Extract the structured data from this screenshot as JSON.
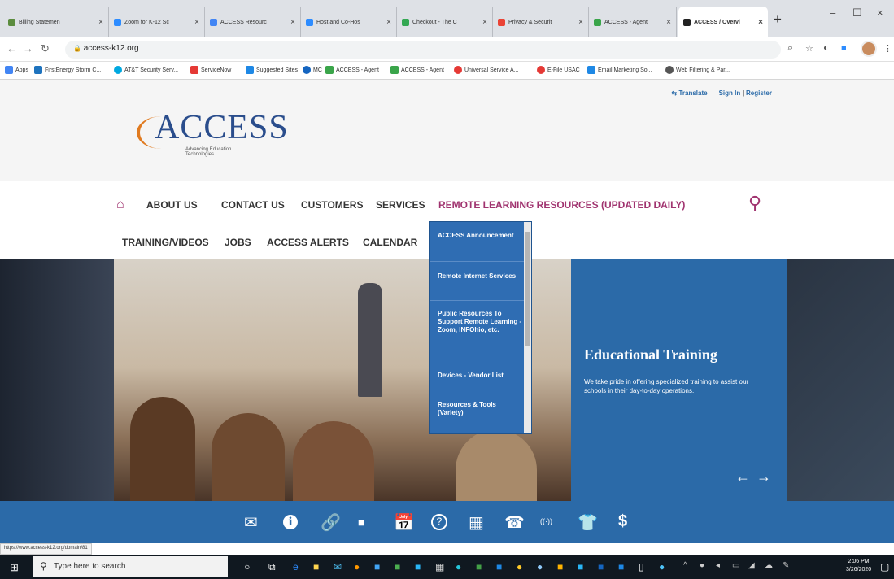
{
  "browser": {
    "tabs": [
      {
        "title": "Billing Statemen",
        "color": "#5b8c3e"
      },
      {
        "title": "Zoom for K-12 Sc",
        "color": "#2d8cff"
      },
      {
        "title": "ACCESS Resourc",
        "color": "#4285f4"
      },
      {
        "title": "Host and Co-Hos",
        "color": "#2d8cff"
      },
      {
        "title": "Checkout - The C",
        "color": "#34a853"
      },
      {
        "title": "Privacy & Securit",
        "color": "#ea4335"
      },
      {
        "title": "ACCESS - Agent",
        "color": "#3aa54a"
      },
      {
        "title": "ACCESS / Overvi",
        "color": "#222222"
      }
    ],
    "url": "access-k12.org",
    "bookmarks": [
      {
        "label": "Apps",
        "color": "#4285f4"
      },
      {
        "label": "FirstEnergy Storm C...",
        "color": "#1e73be"
      },
      {
        "label": "AT&T Security Serv...",
        "color": "#00a8e0"
      },
      {
        "label": "ServiceNow",
        "color": "#e53935"
      },
      {
        "label": "Suggested Sites",
        "color": "#1e88e5"
      },
      {
        "label": "MC",
        "color": "#1565c0"
      },
      {
        "label": "ACCESS - Agent",
        "color": "#3aa54a"
      },
      {
        "label": "ACCESS - Agent",
        "color": "#3aa54a"
      },
      {
        "label": "Universal Service A...",
        "color": "#e53935"
      },
      {
        "label": "E-File USAC",
        "color": "#e53935"
      },
      {
        "label": "Email Marketing So...",
        "color": "#1e88e5"
      },
      {
        "label": "Web Filtering & Par...",
        "color": "#555555"
      }
    ]
  },
  "site": {
    "top_links": {
      "translate": "Translate",
      "signin": "Sign In",
      "sep": "|",
      "register": "Register"
    },
    "logo": {
      "brand": "ACCESS",
      "tagline": "Advancing Education Technologies"
    },
    "nav_row1": [
      "ABOUT US",
      "CONTACT US",
      "CUSTOMERS",
      "SERVICES",
      "REMOTE LEARNING RESOURCES (UPDATED DAILY)"
    ],
    "nav_row2": [
      "TRAINING/VIDEOS",
      "JOBS",
      "ACCESS ALERTS",
      "CALENDAR"
    ],
    "dropdown": [
      "ACCESS Announcement",
      "Remote Internet Services",
      "Public Resources To Support Remote Learning - Zoom, INFOhio, etc.",
      "Devices - Vendor List",
      "Resources & Tools (Variety)"
    ],
    "hero": {
      "title": "Educational Training",
      "desc": "We take pride in offering specialized training to assist our schools in their day-to-day operations.",
      "prev": "←",
      "next": "→"
    },
    "quick_icons": [
      "✉",
      "ℹ",
      "🔗",
      "■",
      "📅",
      "?",
      "▦",
      "☎",
      "((·))",
      "👕",
      "$"
    ],
    "accent": "#a0336f",
    "panel_blue": "#2b6aa8"
  },
  "status_url": "https://www.access-k12.org/domain/81",
  "taskbar": {
    "search_placeholder": "Type here to search",
    "time": "2:06 PM",
    "date": "3/26/2020"
  }
}
